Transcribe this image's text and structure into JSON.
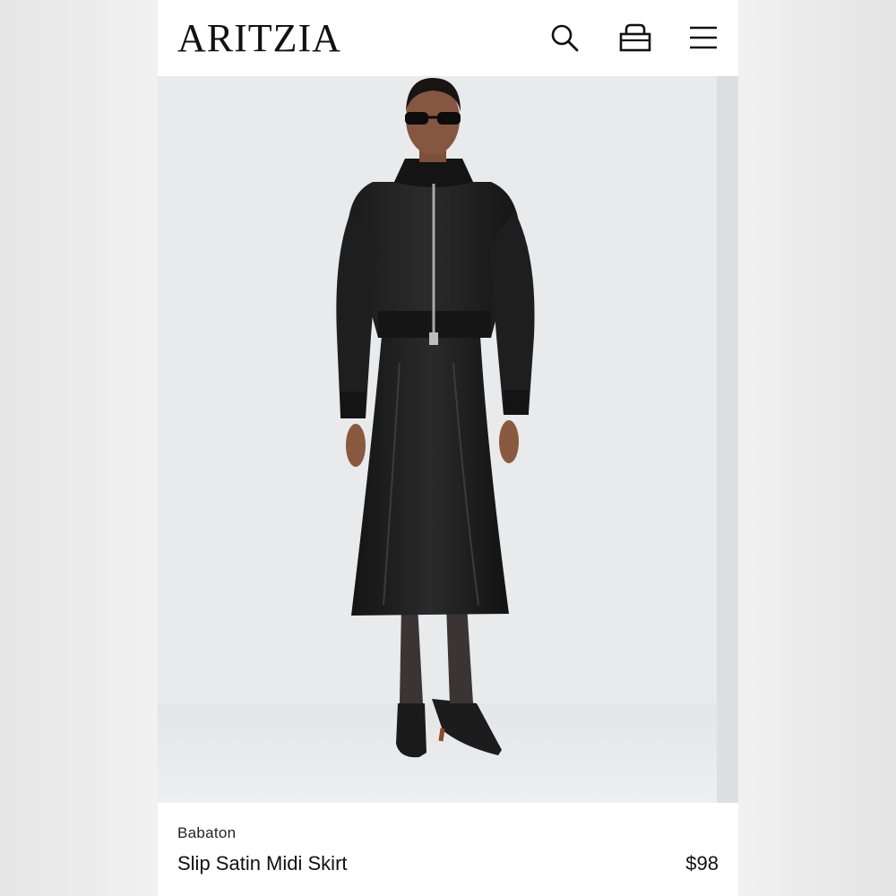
{
  "header": {
    "logo": "ARITZIA",
    "icons": [
      "search-icon",
      "bag-icon",
      "menu-icon"
    ]
  },
  "product": {
    "brand": "Babaton",
    "name": "Slip Satin Midi Skirt",
    "price": "$98"
  },
  "colors": {
    "background": "#ffffff",
    "hero_backdrop": "#e9eaec",
    "text": "#111111"
  }
}
